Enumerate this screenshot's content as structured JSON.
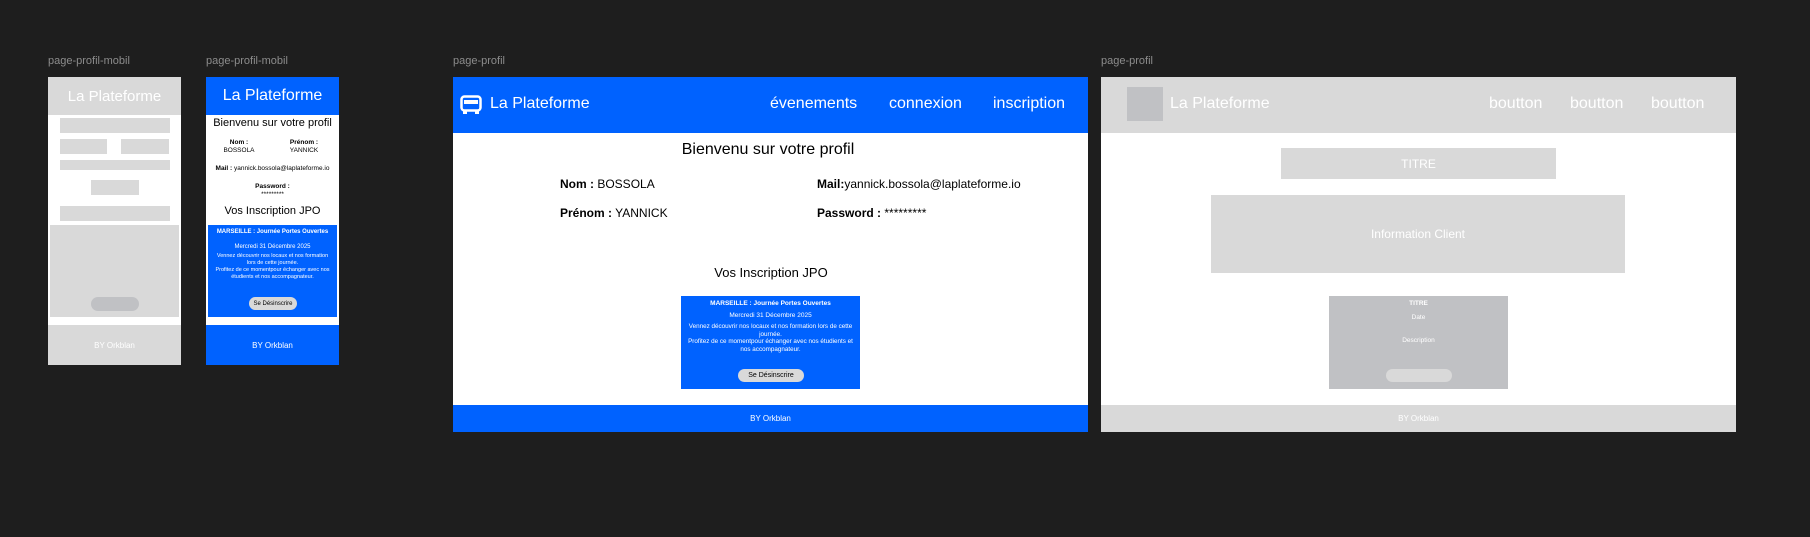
{
  "labels": {
    "frame1": "page-profil-mobil",
    "frame2": "page-profil-mobil",
    "frame3": "page-profil",
    "frame4": "page-profil"
  },
  "wire_mobile": {
    "header_title": "La Plateforme",
    "footer": "BY Orkblan"
  },
  "mobile": {
    "header_title": "La Plateforme",
    "welcome": "Bienvenu sur votre profil",
    "nom_label": "Nom :",
    "nom_value": "BOSSOLA",
    "prenom_label": "Prénom :",
    "prenom_value": "YANNICK",
    "mail_label": "Mail :",
    "mail_value": "yannick.bossola@laplateforme.io",
    "password_label": "Password :",
    "password_value": "*********",
    "section_title": "Vos Inscription JPO",
    "card": {
      "title": "MARSEILLE : Journée Portes Ouvertes",
      "date": "Mercredi 31 Décembre 2025",
      "desc1": "Vennez découvrir nos locaux et nos formation lors de cette journée.",
      "desc2": "Profitez de ce momentpour échanger avec nos étudients et nos accompagnateur.",
      "button": "Se Désinscrire"
    },
    "footer": "BY Orkblan"
  },
  "desktop": {
    "logo_icon": "bus-icon",
    "header_title": "La Plateforme",
    "nav": [
      "évenements",
      "connexion",
      "inscription"
    ],
    "welcome": "Bienvenu sur votre profil",
    "nom_label": "Nom :",
    "nom_value": "BOSSOLA",
    "prenom_label": "Prénom :",
    "prenom_value": "YANNICK",
    "mail_label": "Mail:",
    "mail_value": "yannick.bossola@laplateforme.io",
    "password_label": "Password :",
    "password_value": "*********",
    "section_title": "Vos Inscription JPO",
    "card": {
      "title": "MARSEILLE : Journée Portes Ouvertes",
      "date": "Mercredi 31 Décembre 2025",
      "desc1": "Vennez découvrir nos locaux et nos formation lors de cette journée.",
      "desc2": "Profitez de ce momentpour échanger avec nos étudients et nos accompagnateur.",
      "button": "Se Désinscrire"
    },
    "footer": "BY Orkblan"
  },
  "wire_desktop": {
    "header_title": "La Plateforme",
    "nav": [
      "boutton",
      "boutton",
      "boutton"
    ],
    "titre": "TITRE",
    "info": "Information Client",
    "card_title": "TITRE",
    "card_date": "Date",
    "card_desc": "Description",
    "footer": "BY Orkblan"
  },
  "colors": {
    "canvas": "#1e1e1e",
    "brand_blue": "#0062ff",
    "wire_grey": "#d9d9d9",
    "wire_dark_grey": "#c0c1c4"
  }
}
